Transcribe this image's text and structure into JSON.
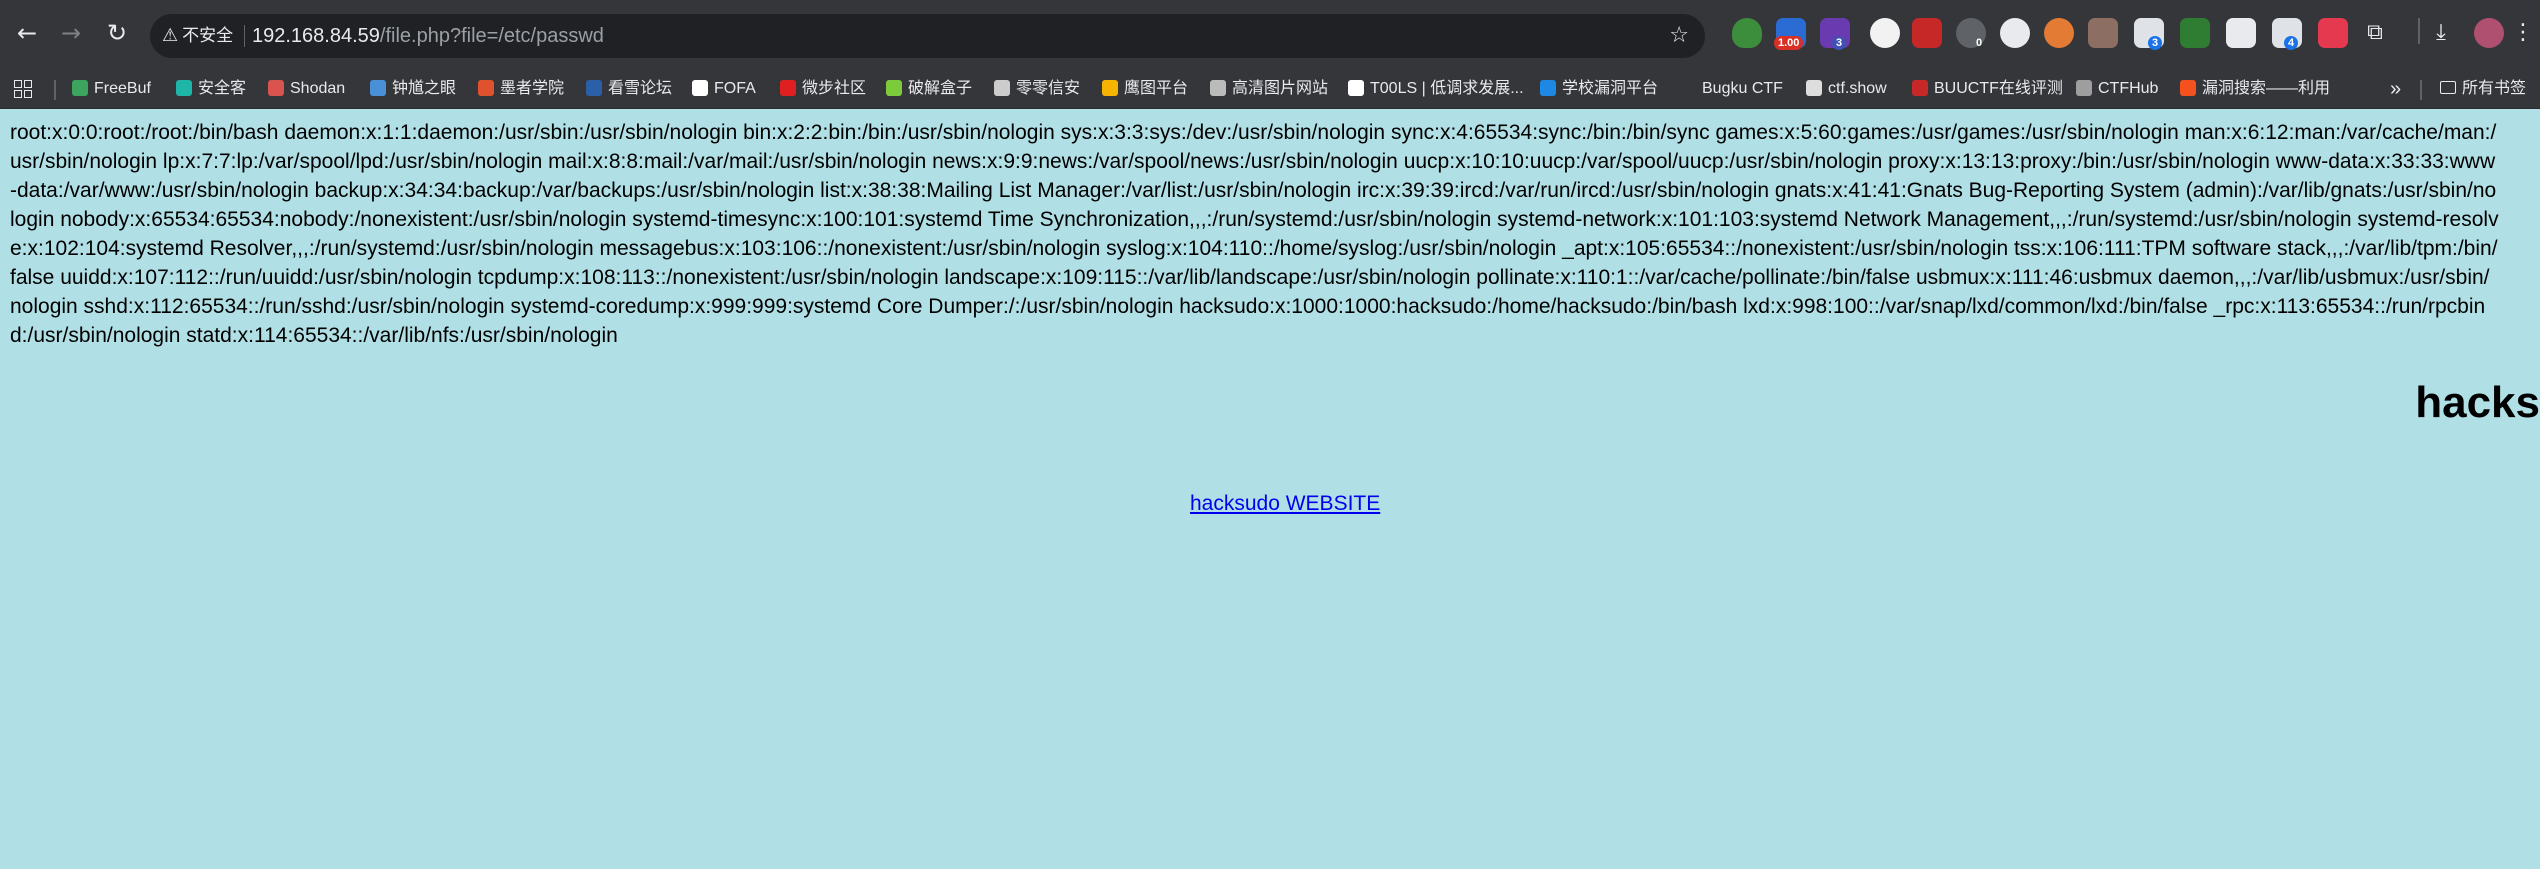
{
  "browser": {
    "security_label": "不安全",
    "url_host": "192.168.84.59",
    "url_path": "/file.php?file=/etc/passwd",
    "extension_badges": [
      "1.00",
      "3",
      "0",
      "3",
      "4"
    ],
    "overflow_symbol": "»",
    "all_bookmarks_label": "所有书签",
    "bookmarks": [
      {
        "label": "FreeBuf",
        "color": "#3ba55d"
      },
      {
        "label": "安全客",
        "color": "#1fb6a8"
      },
      {
        "label": "Shodan",
        "color": "#d9534f"
      },
      {
        "label": "钟馗之眼",
        "color": "#4a90d9"
      },
      {
        "label": "墨者学院",
        "color": "#e0522d"
      },
      {
        "label": "看雪论坛",
        "color": "#2b5fa8"
      },
      {
        "label": "FOFA",
        "color": "#ffffff"
      },
      {
        "label": "微步社区",
        "color": "#e02020"
      },
      {
        "label": "破解盒子",
        "color": "#7ccb3a"
      },
      {
        "label": "零零信安",
        "color": "#cccccc"
      },
      {
        "label": "鹰图平台",
        "color": "#f5b400"
      },
      {
        "label": "高清图片网站",
        "color": "#bbbbbb"
      },
      {
        "label": "T00LS | 低调求发展...",
        "color": "#ffffff"
      },
      {
        "label": "学校漏洞平台",
        "color": "#1e88e5"
      },
      {
        "label": "Bugku CTF",
        "color": "#35363a"
      },
      {
        "label": "ctf.show",
        "color": "#dddddd"
      },
      {
        "label": "BUUCTF在线评测",
        "color": "#c62828"
      },
      {
        "label": "CTFHub",
        "color": "#9e9e9e"
      },
      {
        "label": "漏洞搜索——利用",
        "color": "#f4511e"
      }
    ]
  },
  "page": {
    "passwd_text": "root:x:0:0:root:/root:/bin/bash daemon:x:1:1:daemon:/usr/sbin:/usr/sbin/nologin bin:x:2:2:bin:/bin:/usr/sbin/nologin sys:x:3:3:sys:/dev:/usr/sbin/nologin sync:x:4:65534:sync:/bin:/bin/sync games:x:5:60:games:/usr/games:/usr/sbin/nologin man:x:6:12:man:/var/cache/man:/usr/sbin/nologin lp:x:7:7:lp:/var/spool/lpd:/usr/sbin/nologin mail:x:8:8:mail:/var/mail:/usr/sbin/nologin news:x:9:9:news:/var/spool/news:/usr/sbin/nologin uucp:x:10:10:uucp:/var/spool/uucp:/usr/sbin/nologin proxy:x:13:13:proxy:/bin:/usr/sbin/nologin www-data:x:33:33:www-data:/var/www:/usr/sbin/nologin backup:x:34:34:backup:/var/backups:/usr/sbin/nologin list:x:38:38:Mailing List Manager:/var/list:/usr/sbin/nologin irc:x:39:39:ircd:/var/run/ircd:/usr/sbin/nologin gnats:x:41:41:Gnats Bug-Reporting System (admin):/var/lib/gnats:/usr/sbin/nologin nobody:x:65534:65534:nobody:/nonexistent:/usr/sbin/nologin systemd-timesync:x:100:101:systemd Time Synchronization,,,:/run/systemd:/usr/sbin/nologin systemd-network:x:101:103:systemd Network Management,,,:/run/systemd:/usr/sbin/nologin systemd-resolve:x:102:104:systemd Resolver,,,:/run/systemd:/usr/sbin/nologin messagebus:x:103:106::/nonexistent:/usr/sbin/nologin syslog:x:104:110::/home/syslog:/usr/sbin/nologin _apt:x:105:65534::/nonexistent:/usr/sbin/nologin tss:x:106:111:TPM software stack,,,:/var/lib/tpm:/bin/false uuidd:x:107:112::/run/uuidd:/usr/sbin/nologin tcpdump:x:108:113::/nonexistent:/usr/sbin/nologin landscape:x:109:115::/var/lib/landscape:/usr/sbin/nologin pollinate:x:110:1::/var/cache/pollinate:/bin/false usbmux:x:111:46:usbmux daemon,,,:/var/lib/usbmux:/usr/sbin/nologin sshd:x:112:65534::/run/sshd:/usr/sbin/nologin systemd-coredump:x:999:999:systemd Core Dumper:/:/usr/sbin/nologin hacksudo:x:1000:1000:hacksudo:/home/hacksudo:/bin/bash lxd:x:998:100::/var/snap/lxd/common/lxd:/bin/false _rpc:x:113:65534::/run/rpcbind:/usr/sbin/nologin statd:x:114:65534::/var/lib/nfs:/usr/sbin/nologin",
    "heading": "hacks",
    "link_text": "hacksudo WEBSITE"
  }
}
